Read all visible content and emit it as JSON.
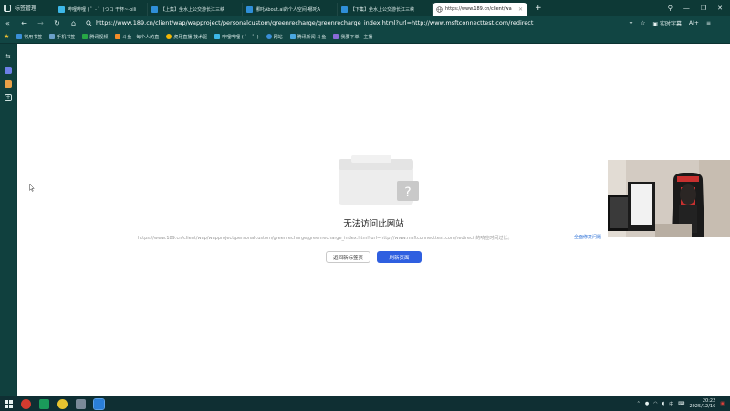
{
  "browser": {
    "tab_manager_label": "标签管理",
    "tabs": [
      {
        "label": "哔哩哔哩 ( ゜- ゜)つロ 干杯~-bili",
        "active": false
      },
      {
        "label": "【上集】坐水上公交游长江三峡",
        "active": false
      },
      {
        "label": "哪吒About.ai的个人空间-哪吒A",
        "active": false
      },
      {
        "label": "【下集】坐水上公交游长江三峡",
        "active": false
      },
      {
        "label": "https://www.189.cn/client/wa",
        "active": true
      }
    ],
    "new_tab": "+",
    "url": "https://www.189.cn/client/wap/wapproject/personalcustom/greenrecharge/greenrecharge_index.html?url=http://www.msftconnecttest.com/redirect",
    "realtime_subtitle_label": "实时字幕",
    "ai_label": "AI+"
  },
  "bookmarks": [
    {
      "label": "常用书签",
      "color": "#3a8fd8"
    },
    {
      "label": "手机书签",
      "color": "#6aa0c8"
    },
    {
      "label": "腾讯视频",
      "color": "#27a745"
    },
    {
      "label": "斗鱼 - 每个人的直",
      "color": "#f28c28"
    },
    {
      "label": "虎牙直播-技术驱",
      "color": "#f2b705"
    },
    {
      "label": "哔哩哔哩 ( ゜- ゜)",
      "color": "#3db8e8"
    },
    {
      "label": "网站",
      "color": "#3a8fd8"
    },
    {
      "label": "腾讯新闻-斗鱼",
      "color": "#4aa8e0"
    },
    {
      "label": "我要下单 - 主播",
      "color": "#8a6ad8"
    }
  ],
  "error_page": {
    "title": "无法访问此网站",
    "detail": "https://www.189.cn/client/wap/wapproject/personalcustom/greenrecharge/greenrecharge_index.html?url=http://www.msftconnecttest.com/redirect 的响应时间过长。",
    "link": "全面修复问题",
    "btn_home": "返回新标签页",
    "btn_refresh": "刷新页面"
  },
  "taskbar": {
    "ime": "中",
    "time": "20:22",
    "date": "2025/12/16"
  },
  "colors": {
    "accent": "#2f5fe0",
    "chrome": "#114543"
  }
}
